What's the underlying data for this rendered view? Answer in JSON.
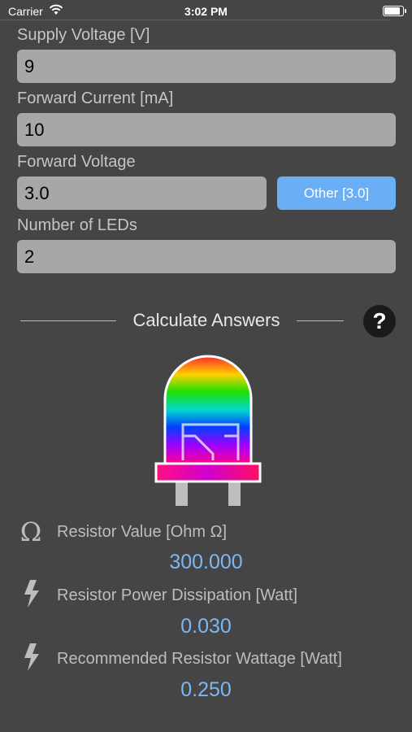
{
  "status_bar": {
    "carrier": "Carrier",
    "time": "3:02 PM"
  },
  "inputs": {
    "supply_voltage": {
      "label": "Supply Voltage [V]",
      "value": "9"
    },
    "forward_current": {
      "label": "Forward Current [mA]",
      "value": "10"
    },
    "forward_voltage": {
      "label": "Forward Voltage",
      "value": "3.0",
      "preset_button": "Other [3.0]"
    },
    "number_of_leds": {
      "label": "Number of LEDs",
      "value": "2"
    }
  },
  "calculate": {
    "label": "Calculate Answers",
    "help": "?"
  },
  "results": {
    "resistor_value": {
      "icon": "omega-icon",
      "label": "Resistor Value [Ohm Ω]",
      "value": "300.000"
    },
    "power_dissipation": {
      "icon": "lightning-icon",
      "label": "Resistor Power Dissipation [Watt]",
      "value": "0.030"
    },
    "recommended_wattage": {
      "icon": "lightning-icon",
      "label": "Recommended Resistor Wattage [Watt]",
      "value": "0.250"
    }
  },
  "colors": {
    "background": "#454545",
    "field": "#a7a7a7",
    "accent": "#6aaef5",
    "result_value": "#7db6f5"
  }
}
